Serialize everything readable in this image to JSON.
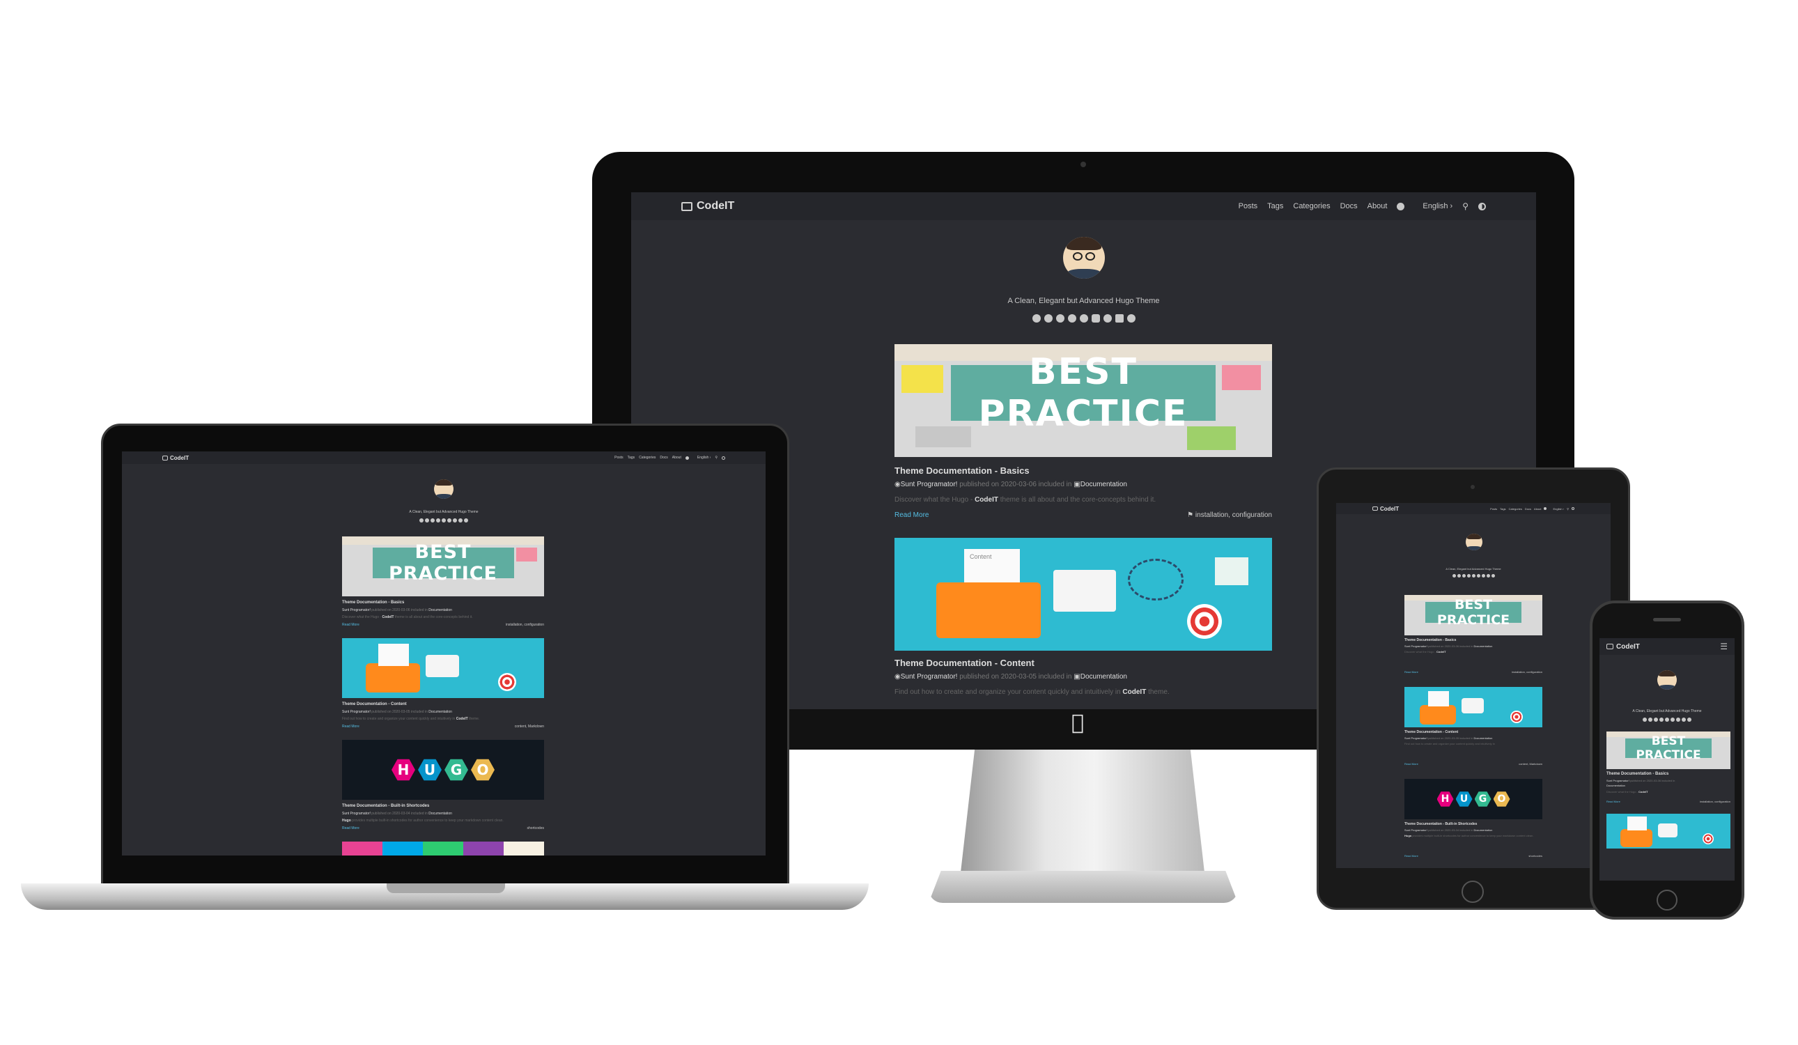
{
  "site": {
    "brand": "CodeIT",
    "nav": [
      "Posts",
      "Tags",
      "Categories",
      "Docs",
      "About"
    ],
    "language": "English",
    "subtitle": "A Clean, Elegant but Advanced Hugo Theme",
    "social_icons": [
      "gitea-icon",
      "twitter-icon",
      "instagram-icon",
      "facebook-icon",
      "telegram-icon",
      "youtube-icon",
      "mastodon-icon",
      "email-icon",
      "rss-icon"
    ],
    "read_more": "Read More",
    "colors": {
      "background": "#2b2c31",
      "header": "#25262b",
      "link": "#55bde2",
      "text": "#a9a9b3"
    }
  },
  "posts": [
    {
      "title": "Theme Documentation - Basics",
      "author": "Sunt Programator!",
      "published": "published on 2020-03-06 included in",
      "category": "Documentation",
      "summary_pre": "Discover what the Hugo - ",
      "summary_bold": "CodeIT",
      "summary_post": " theme is all about and the core-concepts behind it.",
      "tags": "installation, configuration",
      "image": "BEST PRACTICE"
    },
    {
      "title": "Theme Documentation - Content",
      "author": "Sunt Programator!",
      "published": "published on 2020-03-05 included in",
      "category": "Documentation",
      "summary_pre": "Find out how to create and organize your content quickly and intuitively in ",
      "summary_bold": "CodeIT",
      "summary_post": " theme.",
      "tags": "content, Markdown",
      "image": "Content"
    },
    {
      "title": "Theme Documentation - Built-in Shortcodes",
      "author": "Sunt Programator!",
      "published": "published on 2020-03-04 included in",
      "category": "Documentation",
      "summary_pre": "Hugo",
      "summary_bold": "",
      "summary_post": " provides multiple built-in shortcodes for author convenience to keep your markdown content clean.",
      "tags": "shortcodes",
      "image": "HUGO"
    }
  ]
}
